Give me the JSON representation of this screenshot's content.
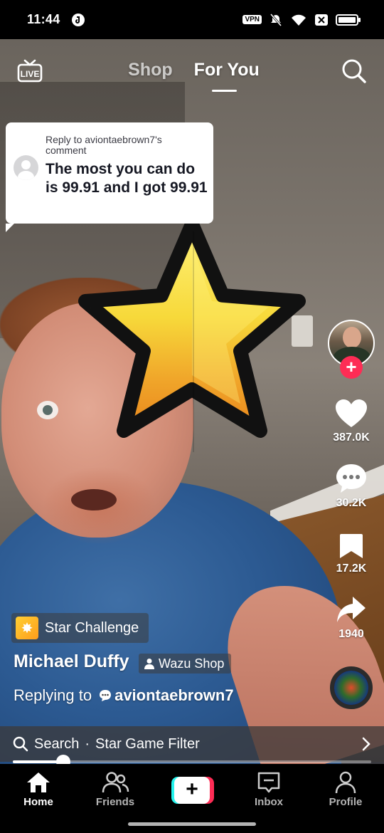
{
  "status_bar": {
    "time": "11:44",
    "vpn_label": "VPN",
    "icons": [
      "tiktok-notification-icon",
      "vpn-icon",
      "mute-icon",
      "wifi-icon",
      "sim-icon",
      "battery-icon"
    ]
  },
  "header": {
    "live_label": "LIVE",
    "tabs": [
      {
        "label": "Shop",
        "active": false
      },
      {
        "label": "For You",
        "active": true
      }
    ]
  },
  "reply_comment": {
    "header": "Reply to aviontaebrown7's comment",
    "text": "The most you can do is 99.91 and I got 99.91"
  },
  "side_actions": {
    "likes": "387.0K",
    "comments": "30.2K",
    "saves": "17.2K",
    "shares": "1940"
  },
  "effect": {
    "label": "Star Challenge"
  },
  "author": {
    "name": "Michael Duffy",
    "shop_label": "Wazu Shop"
  },
  "replying": {
    "prefix": "Replying to",
    "handle": "aviontaebrown7"
  },
  "search_bar": {
    "prefix": "Search",
    "separator": "·",
    "query": "Star Game Filter"
  },
  "progress": {
    "fraction": 0.14
  },
  "bottom_nav": {
    "home": "Home",
    "friends": "Friends",
    "create": "+",
    "inbox": "Inbox",
    "profile": "Profile"
  },
  "colors": {
    "accent_red": "#fe2c55",
    "accent_cyan": "#25f4ee",
    "star_yellow": "#f7d93a",
    "star_orange": "#e9861c"
  }
}
